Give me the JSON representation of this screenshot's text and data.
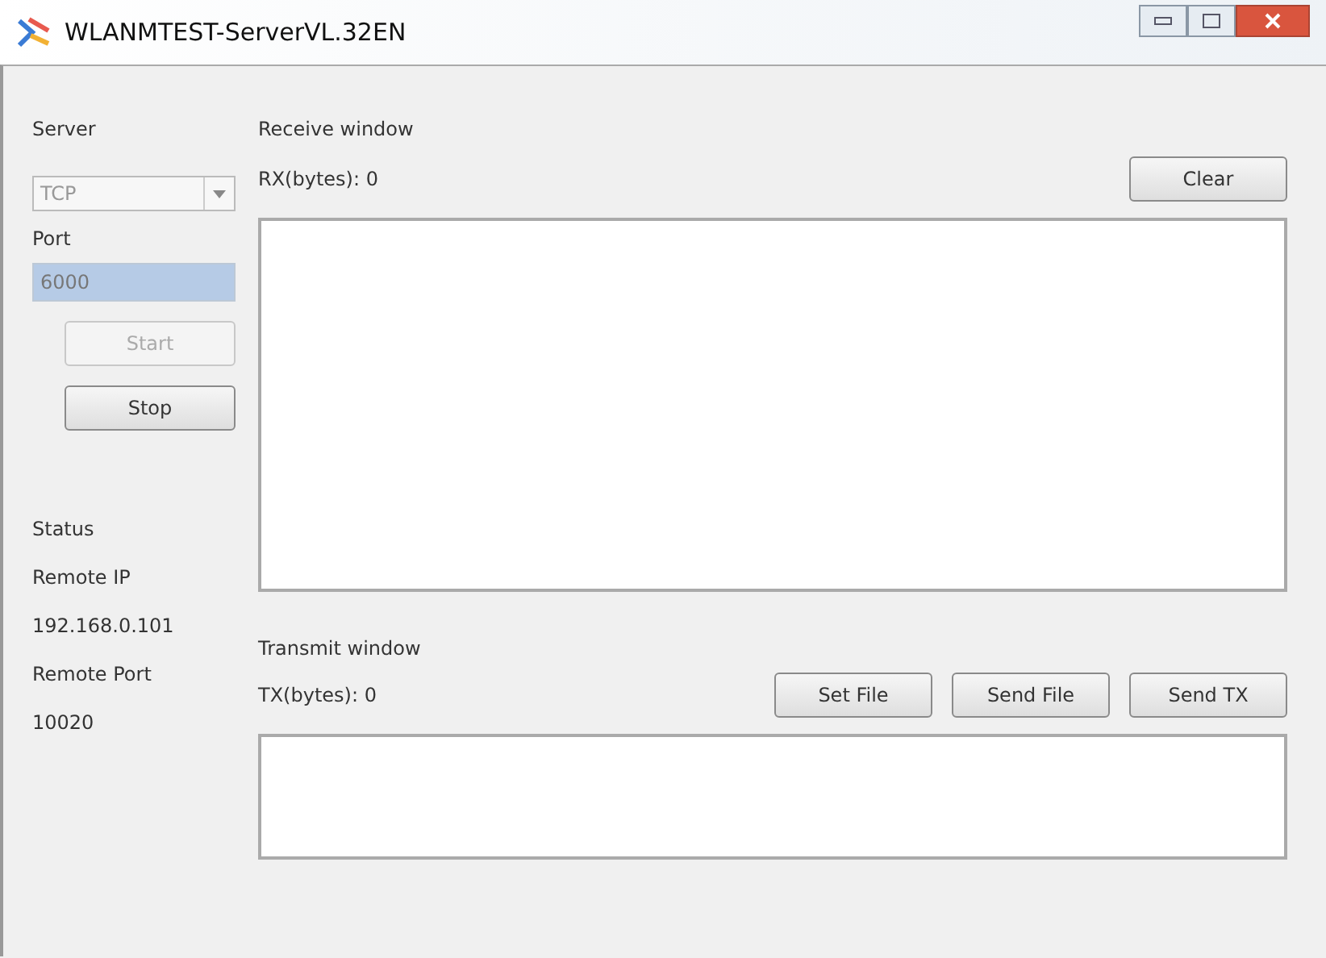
{
  "window": {
    "title": "WLANMTEST-ServerVL.32EN"
  },
  "server": {
    "label": "Server",
    "protocol": {
      "value": "TCP",
      "disabled": true
    },
    "port_label": "Port",
    "port": {
      "value": "6000",
      "selected": true
    },
    "buttons": [
      {
        "label": "Start",
        "disabled": true
      },
      {
        "label": "Stop",
        "disabled": false
      }
    ]
  },
  "receive": {
    "title": "Receive window",
    "counter": "RX(bytes):  0",
    "clear_button": "Clear"
  },
  "status": {
    "label": "Status",
    "remote_ip_label": "Remote IP",
    "remote_ip": "192.168.0.101",
    "remote_port_label": "Remote Port",
    "remote_port": "10020"
  },
  "transmit": {
    "title": "Transmit window",
    "counter": "TX(bytes):  0",
    "buttons": [
      "Set File",
      "Send File",
      "Send TX"
    ]
  }
}
